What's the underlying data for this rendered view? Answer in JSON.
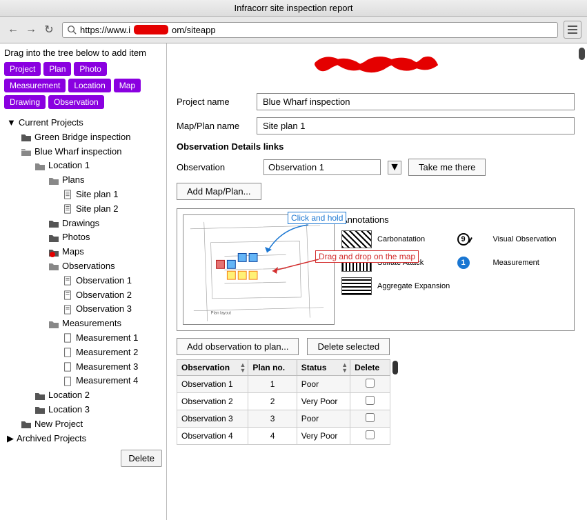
{
  "window_title": "Infracorr site inspection report",
  "url_prefix": "https://www.i",
  "url_suffix": "om/siteapp",
  "sidebar": {
    "drag_label": "Drag into the tree below to add item",
    "tags": [
      "Project",
      "Plan",
      "Photo",
      "Measurement",
      "Location",
      "Map",
      "Drawing",
      "Observation"
    ],
    "delete_label": "Delete"
  },
  "tree": {
    "current": "Current Projects",
    "green": "Green Bridge inspection",
    "blue": "Blue Wharf inspection",
    "loc1": "Location 1",
    "plans": "Plans",
    "sp1": "Site plan 1",
    "sp2": "Site plan 2",
    "drawings": "Drawings",
    "photos": "Photos",
    "maps": "Maps",
    "observations": "Observations",
    "obs1": "Observation 1",
    "obs2": "Observation 2",
    "obs3": "Observation 3",
    "measurements": "Measurements",
    "m1": "Measurement 1",
    "m2": "Measurement 2",
    "m3": "Measurement 3",
    "m4": "Measurement 4",
    "loc2": "Location 2",
    "loc3": "Location 3",
    "newp": "New Project",
    "archived": "Archived Projects"
  },
  "form": {
    "project_label": "Project name",
    "project_value": "Blue Wharf inspection",
    "plan_label": "Map/Plan name",
    "plan_value": "Site plan 1",
    "details_head": "Observation Details links",
    "obs_label": "Observation",
    "obs_value": "Observation 1",
    "take_me": "Take me there",
    "add_map": "Add Map/Plan..."
  },
  "hints": {
    "click": "Click and hold",
    "drag": "Drag and drop on the map"
  },
  "annotations": {
    "head": "Annotations",
    "a1": "Carbonatation",
    "a2": "Sulfate Attack",
    "a3": "Aggregate Expansion",
    "vo": "Visual Observation",
    "meas": "Measurement",
    "vo_num": "9",
    "meas_num": "1"
  },
  "actions": {
    "add_obs": "Add observation to plan...",
    "del_sel": "Delete selected"
  },
  "table": {
    "h1": "Observation",
    "h2": "Plan no.",
    "h3": "Status",
    "h4": "Delete",
    "rows": [
      {
        "obs": "Observation 1",
        "plan": "1",
        "status": "Poor"
      },
      {
        "obs": "Observation 2",
        "plan": "2",
        "status": "Very Poor"
      },
      {
        "obs": "Observation 3",
        "plan": "3",
        "status": "Poor"
      },
      {
        "obs": "Observation 4",
        "plan": "4",
        "status": "Very Poor"
      }
    ]
  }
}
